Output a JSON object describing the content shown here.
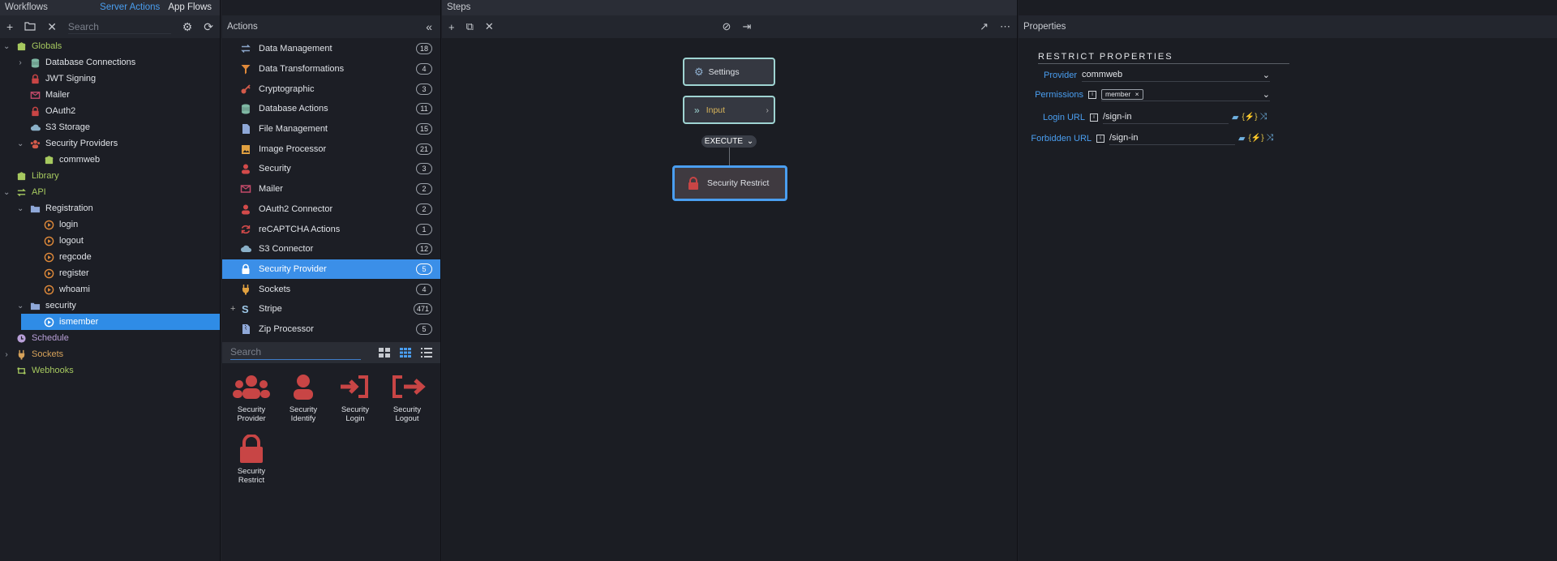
{
  "workflows": {
    "title": "Workflows",
    "tab_server": "Server Actions",
    "tab_app": "App Flows",
    "search_placeholder": "Search",
    "tree": [
      {
        "label": "Globals",
        "level": 0,
        "chev": "v",
        "color": "green",
        "icon": "box-icon"
      },
      {
        "label": "Database Connections",
        "level": 1,
        "chev": ">",
        "color": "",
        "icon": "database-icon"
      },
      {
        "label": "JWT Signing",
        "level": 1,
        "chev": "",
        "color": "",
        "icon": "lock-icon"
      },
      {
        "label": "Mailer",
        "level": 1,
        "chev": "",
        "color": "",
        "icon": "mail-icon"
      },
      {
        "label": "OAuth2",
        "level": 1,
        "chev": "",
        "color": "",
        "icon": "lock-icon"
      },
      {
        "label": "S3 Storage",
        "level": 1,
        "chev": "",
        "color": "",
        "icon": "cloud-icon"
      },
      {
        "label": "Security Providers",
        "level": 1,
        "chev": "v",
        "color": "",
        "icon": "users-icon"
      },
      {
        "label": "commweb",
        "level": 2,
        "chev": "",
        "color": "",
        "icon": "box-icon"
      },
      {
        "label": "Library",
        "level": 0,
        "chev": "",
        "color": "green",
        "icon": "box-icon"
      },
      {
        "label": "API",
        "level": 0,
        "chev": "v",
        "color": "green",
        "icon": "arrows-icon"
      },
      {
        "label": "Registration",
        "level": 1,
        "chev": "v",
        "color": "",
        "icon": "folder-icon"
      },
      {
        "label": "login",
        "level": 2,
        "chev": "",
        "color": "",
        "icon": "play-icon"
      },
      {
        "label": "logout",
        "level": 2,
        "chev": "",
        "color": "",
        "icon": "play-icon"
      },
      {
        "label": "regcode",
        "level": 2,
        "chev": "",
        "color": "",
        "icon": "play-icon"
      },
      {
        "label": "register",
        "level": 2,
        "chev": "",
        "color": "",
        "icon": "play-icon"
      },
      {
        "label": "whoami",
        "level": 2,
        "chev": "",
        "color": "",
        "icon": "play-icon"
      },
      {
        "label": "security",
        "level": 1,
        "chev": "v",
        "color": "",
        "icon": "folder-icon"
      },
      {
        "label": "ismember",
        "level": 2,
        "chev": "",
        "color": "",
        "icon": "play-icon",
        "selected": true
      },
      {
        "label": "Schedule",
        "level": 0,
        "chev": "",
        "color": "purple",
        "icon": "clock-icon"
      },
      {
        "label": "Sockets",
        "level": 0,
        "chev": ">",
        "color": "orange",
        "icon": "plug-icon"
      },
      {
        "label": "Webhooks",
        "level": 0,
        "chev": "",
        "color": "green",
        "icon": "webhook-icon"
      }
    ]
  },
  "actions": {
    "title": "Actions",
    "collapse": "«",
    "items": [
      {
        "label": "Data Management",
        "count": "18",
        "icon": "arrows-icon",
        "color": "#8aa4c8"
      },
      {
        "label": "Data Transformations",
        "count": "4",
        "icon": "filter-icon",
        "color": "#e0893a"
      },
      {
        "label": "Cryptographic",
        "count": "3",
        "icon": "key-icon",
        "color": "#d35a4a"
      },
      {
        "label": "Database Actions",
        "count": "11",
        "icon": "database-icon",
        "color": "#7fb8a4"
      },
      {
        "label": "File Management",
        "count": "15",
        "icon": "file-icon",
        "color": "#8fa8d8"
      },
      {
        "label": "Image Processor",
        "count": "21",
        "icon": "image-icon",
        "color": "#e0a040"
      },
      {
        "label": "Security",
        "count": "3",
        "icon": "user-icon",
        "color": "#d34a4a"
      },
      {
        "label": "Mailer",
        "count": "2",
        "icon": "mail-icon",
        "color": "#c44a6a"
      },
      {
        "label": "OAuth2 Connector",
        "count": "2",
        "icon": "user-icon",
        "color": "#d34a4a"
      },
      {
        "label": "reCAPTCHA Actions",
        "count": "1",
        "icon": "refresh-icon",
        "color": "#d34a4a"
      },
      {
        "label": "S3 Connector",
        "count": "12",
        "icon": "cloud-icon",
        "color": "#8ab0c8"
      },
      {
        "label": "Security Provider",
        "count": "5",
        "icon": "lock-icon",
        "color": "#ffffff",
        "selected": true
      },
      {
        "label": "Sockets",
        "count": "4",
        "icon": "plug-icon",
        "color": "#e0a040"
      },
      {
        "label": "Stripe",
        "count": "471",
        "icon": "stripe-icon",
        "color": "#9ec8e8",
        "plus": "+"
      },
      {
        "label": "Zip Processor",
        "count": "5",
        "icon": "zip-icon",
        "color": "#8fa8d8"
      }
    ],
    "search_placeholder": "Search",
    "tiles": [
      {
        "line1": "Security",
        "line2": "Provider",
        "icon": "users-icon"
      },
      {
        "line1": "Security",
        "line2": "Identify",
        "icon": "user-icon"
      },
      {
        "line1": "Security",
        "line2": "Login",
        "icon": "login-icon"
      },
      {
        "line1": "Security",
        "line2": "Logout",
        "icon": "logout-icon"
      },
      {
        "line1": "Security",
        "line2": "Restrict",
        "icon": "lock-icon"
      }
    ]
  },
  "steps": {
    "title": "Steps",
    "settings_label": "Settings",
    "input_label": "Input",
    "execute_label": "EXECUTE",
    "restrict_label": "Security Restrict"
  },
  "properties": {
    "title": "Properties",
    "section_title": "RESTRICT PROPERTIES",
    "provider_label": "Provider",
    "provider_value": "commweb",
    "permissions_label": "Permissions",
    "permission_tag": "member",
    "login_url_label": "Login URL",
    "login_url_value": "/sign-in",
    "forbidden_url_label": "Forbidden URL",
    "forbidden_url_value": "/sign-in"
  },
  "colors": {
    "accent": "#3b8fe8",
    "node_border": "#9fd4d2",
    "selected_node": "#4a9ef0",
    "danger": "#c84545"
  }
}
